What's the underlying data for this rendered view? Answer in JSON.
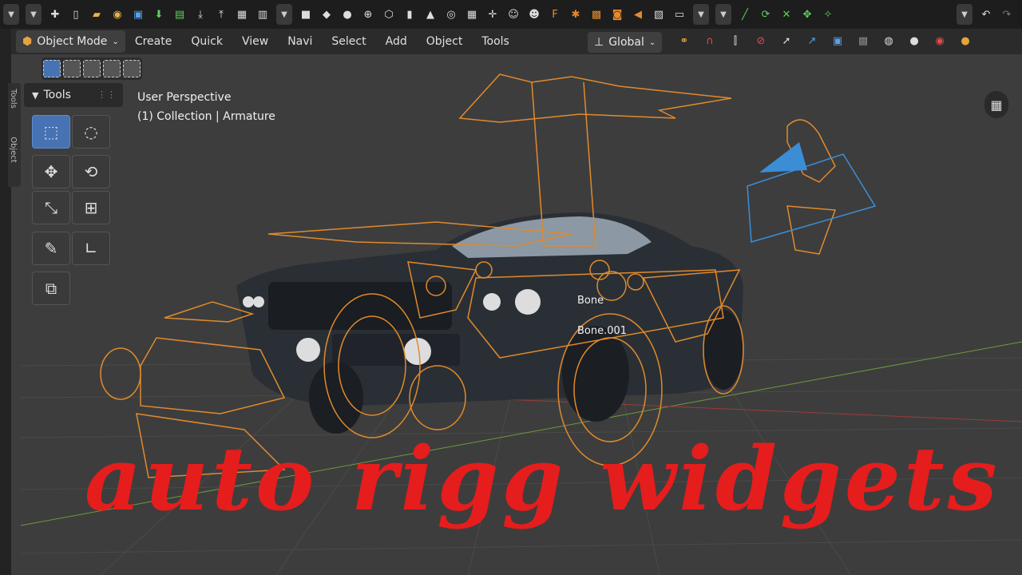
{
  "header": {
    "mode_label": "Object Mode",
    "menu": [
      "Create",
      "Quick",
      "View",
      "Navi",
      "Select",
      "Add",
      "Object",
      "Tools"
    ],
    "transform_orientation": "Global"
  },
  "tools_panel": {
    "title": "Tools",
    "side_tabs": [
      "Tools",
      "Object"
    ]
  },
  "viewport": {
    "perspective_label": "User Perspective",
    "collection_label": "(1) Collection | Armature",
    "bone_labels": [
      "Bone",
      "Bone.001"
    ],
    "overlay_title": "auto rigg widgets"
  },
  "colors": {
    "topbar": "#1d1d1d",
    "menubar": "#2b2b2b",
    "viewport_bg": "#3d3d3d",
    "active_blue": "#4772b3",
    "rig_orange": "#e08a2c",
    "title_red": "#e51d1d",
    "camera_blue": "#3b8ed6"
  },
  "icons": [
    "new-file-icon",
    "open-folder-icon",
    "save-icon",
    "import-icon",
    "export-icon",
    "cube-mesh-icon",
    "sphere-icon",
    "cylinder-icon",
    "cone-icon",
    "torus-icon",
    "monkey-icon",
    "camera-icon",
    "light-icon",
    "speaker-icon",
    "render-icon",
    "undo-icon",
    "redo-icon",
    "grid-view-icon",
    "select-box-icon",
    "cursor-icon",
    "move-icon",
    "rotate-icon",
    "scale-icon",
    "transform-icon",
    "annotate-icon",
    "measure-icon",
    "add-cube-icon"
  ]
}
